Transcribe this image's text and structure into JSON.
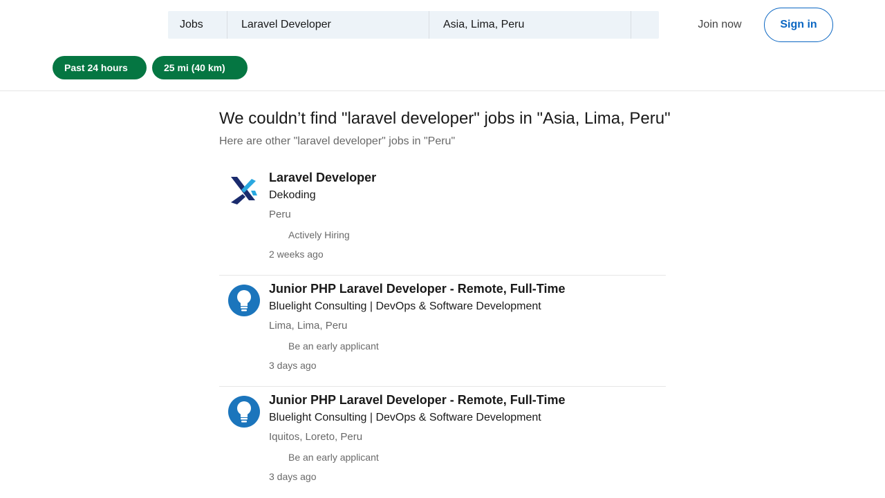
{
  "search": {
    "type_label": "Jobs",
    "keywords": "Laravel Developer",
    "location": "Asia, Lima, Peru"
  },
  "nav": {
    "join_label": "Join now",
    "signin_label": "Sign in"
  },
  "filters": [
    {
      "label": "Past 24 hours"
    },
    {
      "label": "25 mi (40 km)"
    }
  ],
  "results": {
    "title": "We couldn’t find \"laravel developer\" jobs in \"Asia, Lima, Peru\"",
    "subtitle": "Here are other \"laravel developer\" jobs in \"Peru\""
  },
  "jobs": [
    {
      "logo_icon": "dekoding-logo-icon",
      "title": "Laravel Developer",
      "company": "Dekoding",
      "location": "Peru",
      "insight": "Actively Hiring",
      "posted": "2 weeks ago"
    },
    {
      "logo_icon": "lightbulb-logo-icon",
      "title": "Junior PHP Laravel Developer - Remote, Full-Time",
      "company": "Bluelight Consulting | DevOps & Software Development",
      "location": "Lima, Lima, Peru",
      "insight": "Be an early applicant",
      "posted": "3 days ago"
    },
    {
      "logo_icon": "lightbulb-logo-icon",
      "title": "Junior PHP Laravel Developer - Remote, Full-Time",
      "company": "Bluelight Consulting | DevOps & Software Development",
      "location": "Iquitos, Loreto, Peru",
      "insight": "Be an early applicant",
      "posted": "3 days ago"
    }
  ],
  "colors": {
    "accent": "#0a66c2",
    "filter_pill": "#057642",
    "search_bg": "#edf3f8",
    "dekoding_dark": "#1a2b6d",
    "dekoding_light": "#2aa8e0",
    "bluelight": "#1b75bc"
  }
}
